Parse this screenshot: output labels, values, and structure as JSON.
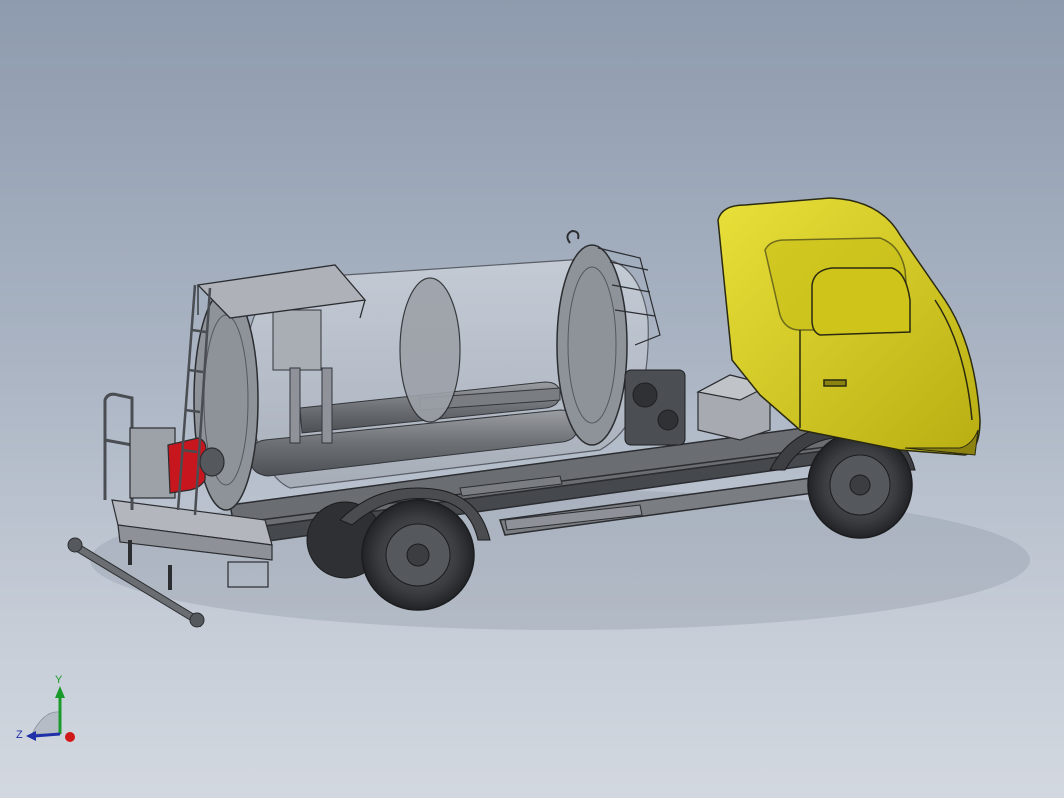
{
  "view": {
    "background_top": "#8e9bae",
    "background_bottom": "#d3d8e0"
  },
  "model": {
    "cab_color": "#d9cf1f",
    "tank_color": "#c9ced6",
    "chassis_color": "#55585d",
    "accent_color": "#c8161e"
  },
  "triad": {
    "x_label": "",
    "y_label": "Y",
    "z_label": "Z",
    "x_color": "#d01818",
    "y_color": "#1a9a2a",
    "z_color": "#1f2fa8"
  }
}
